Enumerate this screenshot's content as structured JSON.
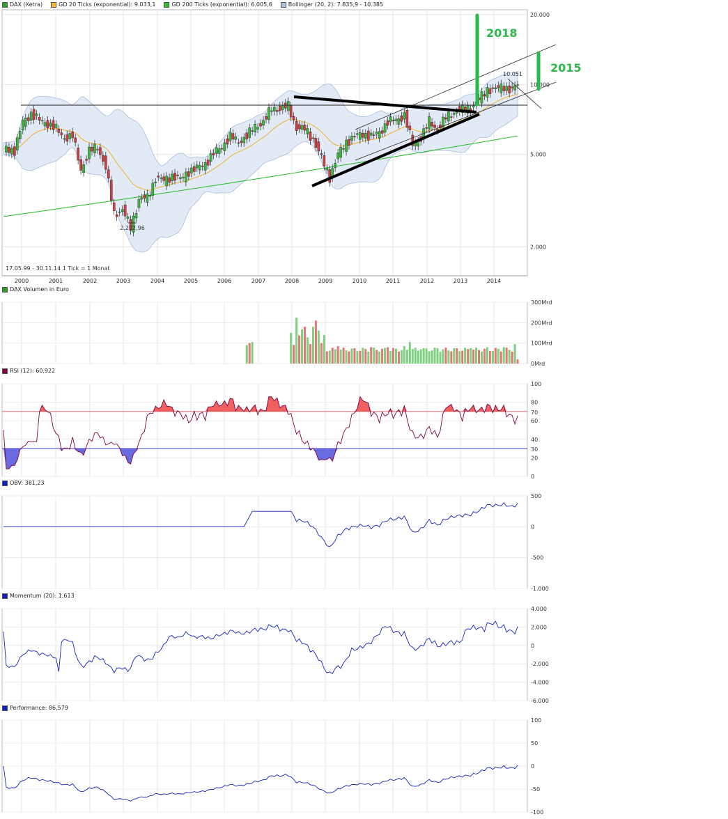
{
  "legend_main": [
    {
      "label": "DAX (Xetra)",
      "color": "#2ea02e"
    },
    {
      "label": "GD 20 Ticks (exponential): 9.033,1",
      "color": "#f5b830"
    },
    {
      "label": "GD 200 Ticks (exponential): 6.005,6",
      "color": "#2ec02e"
    },
    {
      "label": "Bollinger (20, 2): 7.835,9 - 10.385",
      "color": "#b0c4e0"
    }
  ],
  "footnote": "17.05.99 - 30.11.14   1 Tick = 1 Monat",
  "low_label": "2.202,96",
  "high_label": "10.051",
  "annotations": {
    "a2018": "2018",
    "a2015": "2015"
  },
  "legend_volume": {
    "label": "DAX Volumen in Euro",
    "color": "#2ea02e"
  },
  "legend_rsi": {
    "label": "RSI (12): 60,922",
    "color": "#800040"
  },
  "legend_obv": {
    "label": "OBV: 381,23",
    "color": "#1020c0"
  },
  "legend_momentum": {
    "label": "Momentum (20): 1.613",
    "color": "#1020c0"
  },
  "legend_performance": {
    "label": "Performance: 86,579",
    "color": "#1020c0"
  },
  "chart_data": [
    {
      "type": "candlestick",
      "title": "DAX (Xetra)",
      "x_ticks": [
        "2000",
        "2001",
        "2002",
        "2003",
        "2004",
        "2005",
        "2006",
        "2007",
        "2008",
        "2009",
        "2010",
        "2011",
        "2012",
        "2013",
        "2014"
      ],
      "y_scale": "log",
      "y_ticks": [
        "20.000",
        "10.000",
        "5.000",
        "2.000"
      ],
      "ylim": [
        1500,
        21000
      ],
      "months": [
        "1999-06",
        "1999-09",
        "1999-12",
        "2000-03",
        "2000-06",
        "2000-09",
        "2000-12",
        "2001-03",
        "2001-06",
        "2001-09",
        "2001-12",
        "2002-03",
        "2002-06",
        "2002-09",
        "2002-12",
        "2003-03",
        "2003-06",
        "2003-09",
        "2003-12",
        "2004-03",
        "2004-06",
        "2004-09",
        "2004-12",
        "2005-03",
        "2005-06",
        "2005-09",
        "2005-12",
        "2006-03",
        "2006-06",
        "2006-09",
        "2006-12",
        "2007-03",
        "2007-06",
        "2007-09",
        "2007-12",
        "2008-03",
        "2008-06",
        "2008-09",
        "2008-12",
        "2009-03",
        "2009-06",
        "2009-09",
        "2009-12",
        "2010-03",
        "2010-06",
        "2010-09",
        "2010-12",
        "2011-03",
        "2011-06",
        "2011-09",
        "2011-12",
        "2012-03",
        "2012-06",
        "2012-09",
        "2012-12",
        "2013-03",
        "2013-06",
        "2013-09",
        "2013-12",
        "2014-03",
        "2014-06",
        "2014-09",
        "2014-11"
      ],
      "close": [
        5300,
        5200,
        6900,
        7500,
        7000,
        6800,
        6430,
        5900,
        6000,
        4300,
        5160,
        5400,
        4380,
        2770,
        2890,
        2420,
        3200,
        3250,
        3965,
        3850,
        4050,
        3900,
        4250,
        4350,
        4580,
        5040,
        5410,
        5970,
        5680,
        5990,
        6600,
        6900,
        7900,
        7860,
        8070,
        6500,
        6420,
        5830,
        4810,
        4000,
        4990,
        5670,
        5960,
        6150,
        5970,
        6230,
        6910,
        7040,
        7380,
        5500,
        5900,
        6950,
        6400,
        7210,
        7610,
        7800,
        7960,
        8590,
        9550,
        9550,
        9800,
        9470,
        9980
      ],
      "series": [
        {
          "name": "GD 20 Ticks (exponential)",
          "last": 9033.1
        },
        {
          "name": "GD 200 Ticks (exponential)",
          "last": 6005.6
        },
        {
          "name": "Bollinger (20, 2)",
          "lower": 7835.9,
          "upper": 10385
        }
      ],
      "annotations": [
        "2.202,96",
        "10.051",
        "2018",
        "2015"
      ]
    },
    {
      "type": "bar",
      "title": "DAX Volumen in Euro",
      "y_ticks": [
        "300Mrd",
        "200Mrd",
        "100Mrd",
        "0Mrd"
      ],
      "ylim": [
        0,
        300
      ],
      "unit": "Mrd",
      "periods": [
        "2006-09",
        "2006-10",
        "2006-11",
        "2008-01",
        "2008-03",
        "2008-06",
        "2008-09",
        "2008-10",
        "2008-12",
        "2009-06",
        "2009-12",
        "2010-06",
        "2010-12",
        "2011-06",
        "2011-08",
        "2011-12",
        "2012-06",
        "2012-12",
        "2013-06",
        "2013-12",
        "2014-06",
        "2014-10",
        "2014-11"
      ],
      "values": [
        90,
        100,
        105,
        150,
        225,
        180,
        180,
        210,
        100,
        85,
        75,
        80,
        80,
        85,
        105,
        70,
        75,
        75,
        75,
        80,
        80,
        95,
        20
      ]
    },
    {
      "type": "line",
      "title": "RSI (12)",
      "last": 60.922,
      "y_ticks": [
        "100",
        "80",
        "70",
        "60",
        "40",
        "30",
        "20",
        "0"
      ],
      "ylim": [
        0,
        100
      ],
      "reference_lines": [
        70,
        30
      ]
    },
    {
      "type": "line",
      "title": "OBV",
      "last": 381.23,
      "y_ticks": [
        "500",
        "0",
        "-500",
        "-1.000"
      ],
      "ylim": [
        -1000,
        500
      ]
    },
    {
      "type": "line",
      "title": "Momentum (20)",
      "last": 1613,
      "y_ticks": [
        "4.000",
        "2.000",
        "0",
        "-2.000",
        "-4.000",
        "-6.000"
      ],
      "ylim": [
        -6000,
        4000
      ]
    },
    {
      "type": "line",
      "title": "Performance",
      "last": 86.579,
      "y_ticks": [
        "100",
        "50",
        "0",
        "-50",
        "-100"
      ],
      "ylim": [
        -100,
        100
      ]
    }
  ]
}
